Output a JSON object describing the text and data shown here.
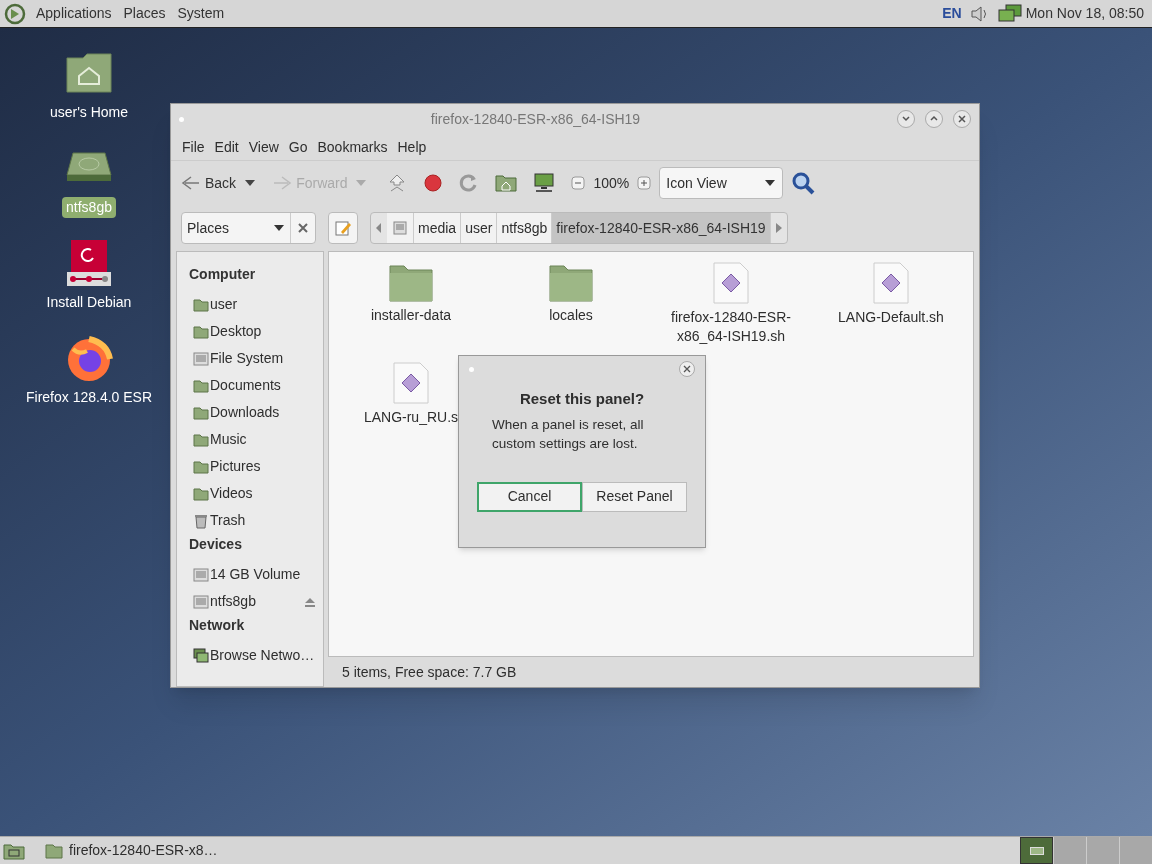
{
  "top_panel": {
    "menus": [
      "Applications",
      "Places",
      "System"
    ],
    "keyboard": "EN",
    "clock": "Mon Nov 18, 08:50"
  },
  "desktop_icons": [
    {
      "label": "user's Home",
      "kind": "home",
      "selected": false
    },
    {
      "label": "ntfs8gb",
      "kind": "drive",
      "selected": true
    },
    {
      "label": "Install Debian",
      "kind": "installer",
      "selected": false
    },
    {
      "label": "Firefox 128.4.0 ESR",
      "kind": "firefox",
      "selected": false
    }
  ],
  "window": {
    "title": "firefox-12840-ESR-x86_64-ISH19",
    "menu": [
      "File",
      "Edit",
      "View",
      "Go",
      "Bookmarks",
      "Help"
    ],
    "toolbar": {
      "back": {
        "label": "Back",
        "disabled": false
      },
      "forward": {
        "label": "Forward",
        "disabled": true
      },
      "zoom": "100%",
      "view": "Icon View"
    },
    "places": "Places",
    "path": [
      {
        "label": "media",
        "selected": false
      },
      {
        "label": "user",
        "selected": false
      },
      {
        "label": "ntfs8gb",
        "selected": false
      },
      {
        "label": "firefox-12840-ESR-x86_64-ISH19",
        "selected": true
      }
    ],
    "sidebar": [
      {
        "heading": "Computer",
        "items": [
          {
            "label": "user",
            "kind": "folder"
          },
          {
            "label": "Desktop",
            "kind": "folder"
          },
          {
            "label": "File System",
            "kind": "disk"
          },
          {
            "label": "Documents",
            "kind": "folder"
          },
          {
            "label": "Downloads",
            "kind": "folder"
          },
          {
            "label": "Music",
            "kind": "folder"
          },
          {
            "label": "Pictures",
            "kind": "folder"
          },
          {
            "label": "Videos",
            "kind": "folder"
          },
          {
            "label": "Trash",
            "kind": "trash"
          }
        ]
      },
      {
        "heading": "Devices",
        "items": [
          {
            "label": "14 GB Volume",
            "kind": "disk"
          },
          {
            "label": "ntfs8gb",
            "kind": "disk",
            "eject": true
          }
        ]
      },
      {
        "heading": "Network",
        "items": [
          {
            "label": "Browse Netwo…",
            "kind": "network"
          }
        ]
      }
    ],
    "files": [
      {
        "name": "installer-data",
        "kind": "folder"
      },
      {
        "name": "locales",
        "kind": "folder"
      },
      {
        "name": "firefox-12840-ESR-x86_64-ISH19.sh",
        "kind": "script"
      },
      {
        "name": "LANG-Default.sh",
        "kind": "script"
      },
      {
        "name": "LANG-ru_RU.s",
        "kind": "script"
      }
    ],
    "status": "5 items, Free space: 7.7 GB"
  },
  "dialog": {
    "title": "Reset this panel?",
    "message": "When a panel is reset, all custom settings are lost.",
    "buttons": [
      {
        "label": "Cancel",
        "focused": true
      },
      {
        "label": "Reset Panel",
        "focused": false
      }
    ]
  },
  "taskbar": {
    "tasks": [
      {
        "label": "firefox-12840-ESR-x8…"
      }
    ]
  }
}
